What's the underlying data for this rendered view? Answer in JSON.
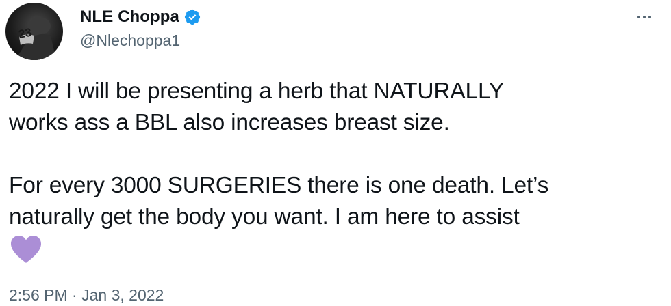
{
  "author": {
    "display_name": "NLE Choppa",
    "handle": "@Nlechoppa1",
    "verified": true,
    "avatar_icon": "avatar-image",
    "jersey_number": "23"
  },
  "more_icon": "more-horizontal-icon",
  "tweet": {
    "lines": [
      "2022 I will be presenting a herb that NATURALLY",
      "works ass a BBL also increases breast size.",
      "For every 3000 SURGERIES there is one death. Let’s",
      "naturally get the body you want. I am here to assist"
    ],
    "emoji": "purple-heart-icon"
  },
  "timestamp": {
    "time": "2:56 PM",
    "separator": "·",
    "date": "Jan 3, 2022"
  },
  "colors": {
    "verified_blue": "#1d9bf0",
    "heart_purple": "#ab8ed6",
    "secondary_text": "#536471",
    "primary_text": "#0f1419"
  }
}
